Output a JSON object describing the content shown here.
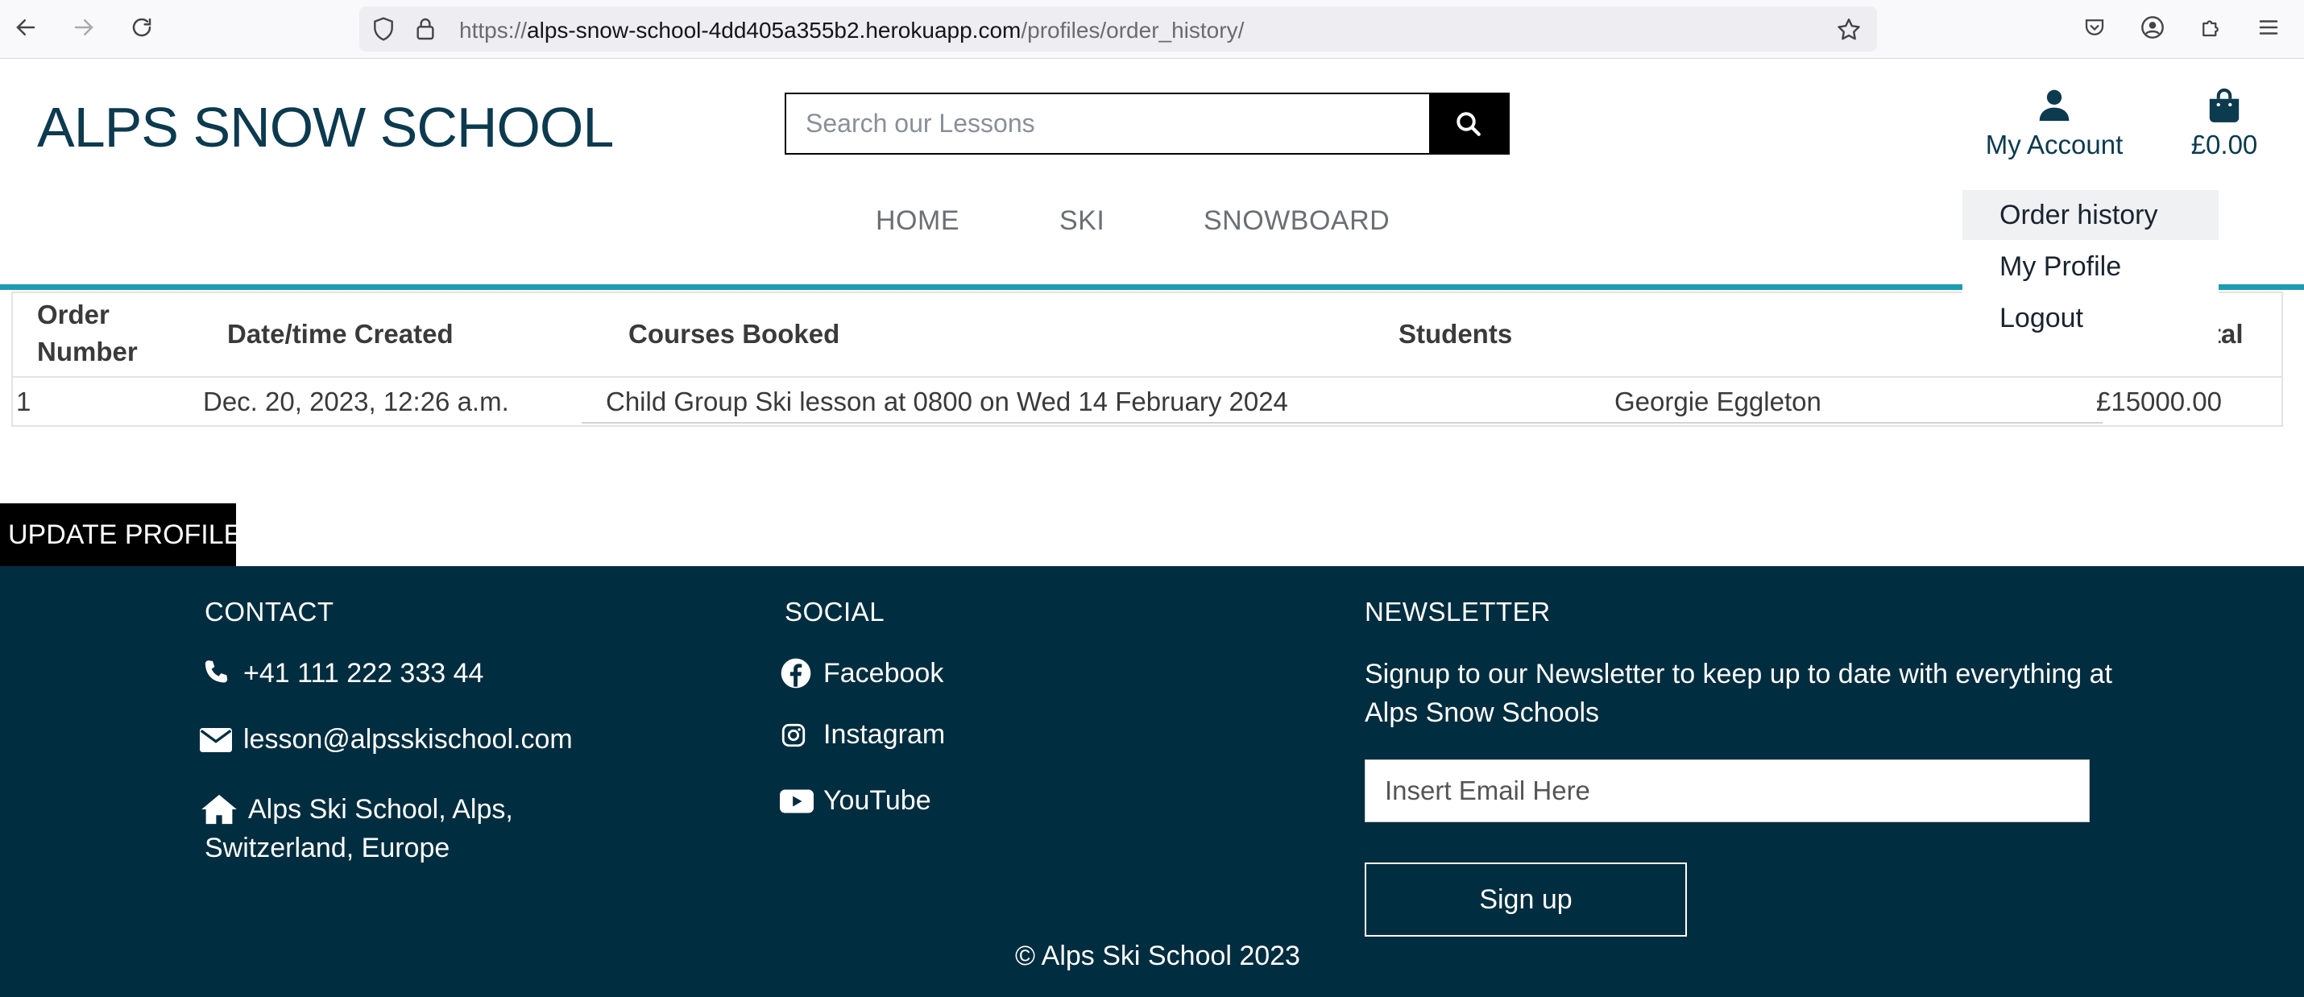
{
  "browser": {
    "url_prefix": "https://",
    "url_host": "alps-snow-school-4dd405a355b2.herokuapp.com",
    "url_path": "/profiles/order_history/"
  },
  "header": {
    "brand": "ALPS SNOW SCHOOL",
    "search_placeholder": "Search our Lessons",
    "account_label": "My Account",
    "bag_total": "£0.00"
  },
  "nav": {
    "home": "HOME",
    "ski": "SKI",
    "snowboard": "SNOWBOARD"
  },
  "account_menu": {
    "order_history": "Order history",
    "my_profile": "My Profile",
    "logout": "Logout"
  },
  "table": {
    "headers": {
      "order_number_1": "Order",
      "order_number_2": "Number",
      "date": "Date/time Created",
      "courses": "Courses Booked",
      "students": "Students",
      "total": "tal"
    },
    "rows": [
      {
        "number": "1",
        "date": "Dec. 20, 2023, 12:26 a.m.",
        "course": "Child Group Ski lesson at 0800 on Wed 14 February 2024",
        "student": "Georgie Eggleton",
        "total": "£15000.00"
      }
    ]
  },
  "update_profile": "UPDATE PROFILE",
  "footer": {
    "contact_heading": "CONTACT",
    "phone": "+41 111 222 333 44",
    "email": "lesson@alpsskischool.com",
    "address_line1": "Alps Ski School, Alps,",
    "address_line2": "Switzerland, Europe",
    "social_heading": "SOCIAL",
    "facebook": "Facebook",
    "instagram": "Instagram",
    "youtube": "YouTube",
    "newsletter_heading": "NEWSLETTER",
    "newsletter_text_1": "Signup to our Newsletter to keep up to date with everything at",
    "newsletter_text_2": "Alps Snow Schools",
    "email_placeholder": "Insert Email Here",
    "signup_label": "Sign up",
    "copyright": "© Alps Ski School 2023"
  }
}
